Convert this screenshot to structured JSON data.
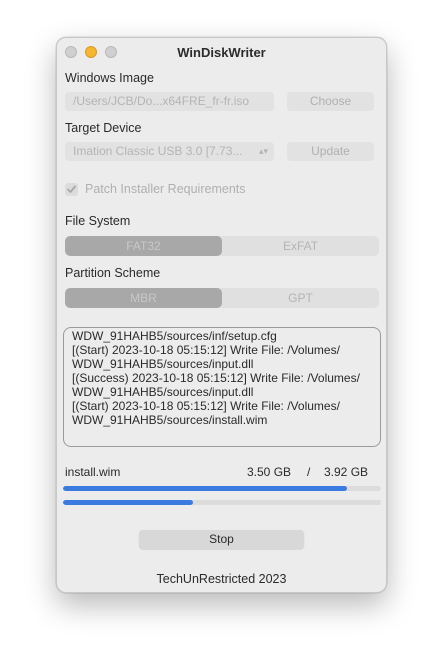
{
  "window": {
    "title": "WinDiskWriter"
  },
  "windows_image": {
    "label": "Windows Image",
    "path_value": "/Users/JCB/Do...x64FRE_fr-fr.iso",
    "choose_label": "Choose"
  },
  "target_device": {
    "label": "Target Device",
    "selected": "Imation Classic USB 3.0 [7.73...",
    "update_label": "Update"
  },
  "patch": {
    "label": "Patch Installer Requirements",
    "checked": true
  },
  "file_system": {
    "label": "File System",
    "options": [
      "FAT32",
      "ExFAT"
    ],
    "selected_index": 0
  },
  "partition_scheme": {
    "label": "Partition Scheme",
    "options": [
      "MBR",
      "GPT"
    ],
    "selected_index": 0
  },
  "log": {
    "lines": [
      "WDW_91HAHB5/sources/inf/setup.cfg",
      "[(Start) 2023-10-18 05:15:12] Write File: /Volumes/",
      "WDW_91HAHB5/sources/input.dll",
      "[(Success) 2023-10-18 05:15:12] Write File: /Volumes/",
      "WDW_91HAHB5/sources/input.dll",
      "[(Start) 2023-10-18 05:15:12] Write File: /Volumes/",
      "WDW_91HAHB5/sources/install.wim"
    ]
  },
  "progress": {
    "file_name": "install.wim",
    "written": "3.50 GB",
    "separator": "/",
    "total": "3.92 GB",
    "file_fraction": 0.893,
    "overall_fraction": 0.41,
    "accent_color": "#3b7be0"
  },
  "actions": {
    "stop_label": "Stop"
  },
  "footer": {
    "text": "TechUnRestricted 2023"
  }
}
